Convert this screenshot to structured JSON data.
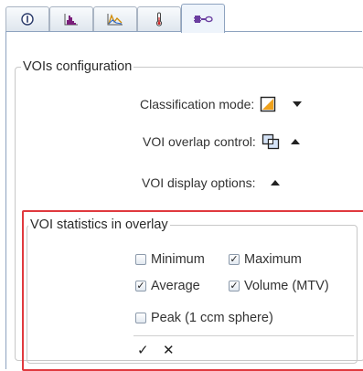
{
  "tabs": [
    {
      "icon": "info-icon"
    },
    {
      "icon": "histogram-icon"
    },
    {
      "icon": "curves-icon"
    },
    {
      "icon": "thermometer-icon"
    },
    {
      "icon": "voi-tools-icon",
      "active": true
    }
  ],
  "vois_group": {
    "title": "VOIs configuration",
    "classification_label": "Classification mode:",
    "overlap_label": "VOI overlap control:",
    "display_label": "VOI display options:"
  },
  "stats_group": {
    "title": "VOI statistics in overlay",
    "minimum": {
      "label": "Minimum",
      "checked": false
    },
    "maximum": {
      "label": "Maximum",
      "checked": true
    },
    "average": {
      "label": "Average",
      "checked": true
    },
    "volume": {
      "label": "Volume (MTV)",
      "checked": true
    },
    "peak": {
      "label": "Peak (1 ccm sphere)",
      "checked": false
    },
    "check_glyph": "✓",
    "cross_glyph": "✕"
  },
  "colors": {
    "highlight": "#e0393e",
    "border": "#c8c8c8"
  }
}
